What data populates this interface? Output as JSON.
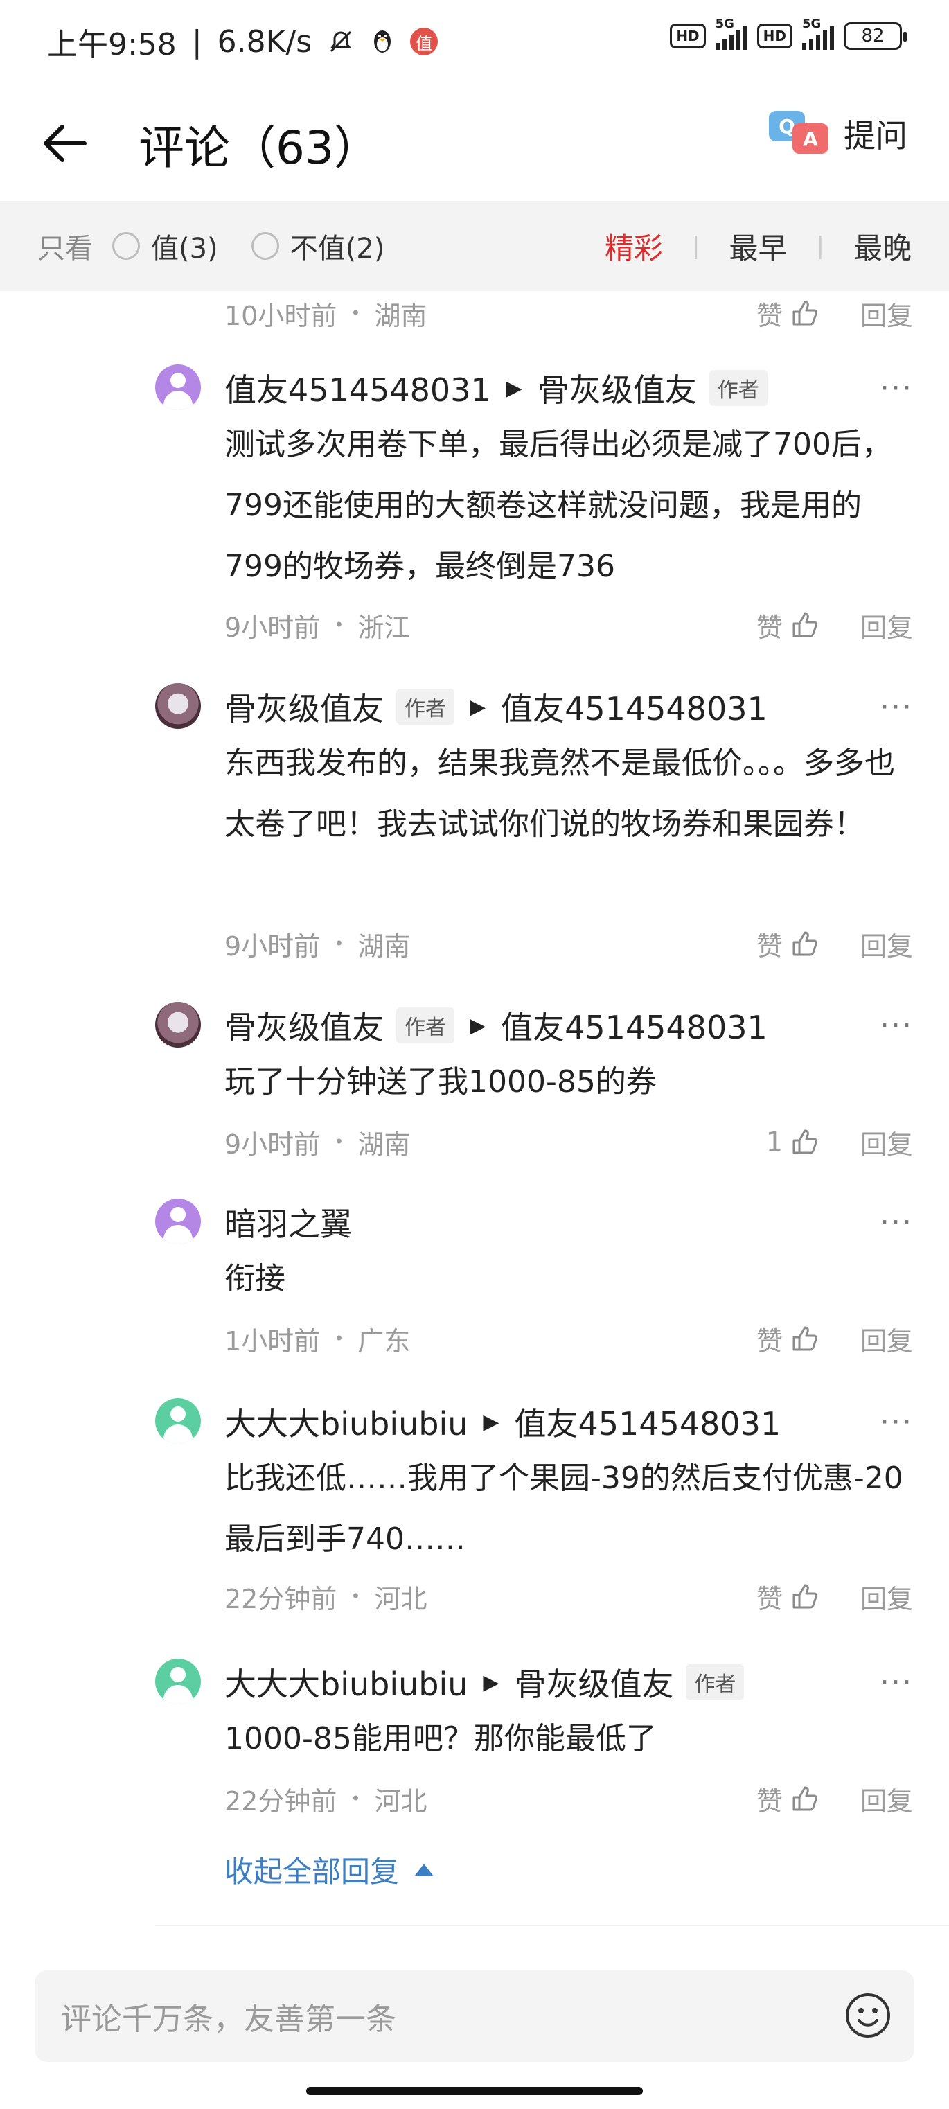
{
  "status_bar": {
    "time": "上午9:58",
    "net_speed": "6.8K/s",
    "app_badge": "值",
    "hd1": "HD",
    "sig1": "5G",
    "hd2": "HD",
    "sig2": "5G",
    "battery": "82"
  },
  "header": {
    "title": "评论（63）",
    "ask_label": "提问",
    "qa_q": "Q",
    "qa_a": "A"
  },
  "filter": {
    "only_label": "只看",
    "opt1": "值(3)",
    "opt2": "不值(2)",
    "sort": [
      "精彩",
      "最早",
      "最晚"
    ],
    "active_sort": "精彩"
  },
  "top_meta": {
    "time": "10小时前",
    "region": "湖南",
    "like": "赞",
    "reply": "回复"
  },
  "comments": [
    {
      "user": "值友4514548031",
      "reply_to": "骨灰级值友",
      "reply_to_author_tag": "作者",
      "user_author_tag": "",
      "text": "测试多次用卷下单，最后得出必须是减了700后，799还能使用的大额卷这样就没问题，我是用的799的牧场券，最终倒是736",
      "time": "9小时前",
      "region": "浙江",
      "like": "赞",
      "reply": "回复"
    },
    {
      "user": "骨灰级值友",
      "user_author_tag": "作者",
      "reply_to": "值友4514548031",
      "text": "东西我发布的，结果我竟然不是最低价。。。多多也太卷了吧！我去试试你们说的牧场券和果园券！",
      "time": "9小时前",
      "region": "湖南",
      "like": "赞",
      "reply": "回复"
    },
    {
      "user": "骨灰级值友",
      "user_author_tag": "作者",
      "reply_to": "值友4514548031",
      "text": "玩了十分钟送了我1000-85的券",
      "time": "9小时前",
      "region": "湖南",
      "like": "1",
      "reply": "回复"
    },
    {
      "user": "暗羽之翼",
      "text": "衔接",
      "time": "1小时前",
      "region": "广东",
      "like": "赞",
      "reply": "回复"
    },
    {
      "user": "大大大biubiubiu",
      "reply_to": "值友4514548031",
      "text": "比我还低……我用了个果园-39的然后支付优惠-20最后到手740……",
      "time": "22分钟前",
      "region": "河北",
      "like": "赞",
      "reply": "回复"
    },
    {
      "user": "大大大biubiubiu",
      "reply_to": "骨灰级值友",
      "reply_to_author_tag": "作者",
      "text": "1000-85能用吧？那你能最低了",
      "time": "22分钟前",
      "region": "河北",
      "like": "赞",
      "reply": "回复"
    }
  ],
  "collapse_label": "收起全部回复",
  "input_placeholder": "评论千万条，友善第一条",
  "colors": {
    "accent_red": "#e02b2b",
    "link_blue": "#3d7fc4",
    "muted": "#9a9a9a"
  }
}
